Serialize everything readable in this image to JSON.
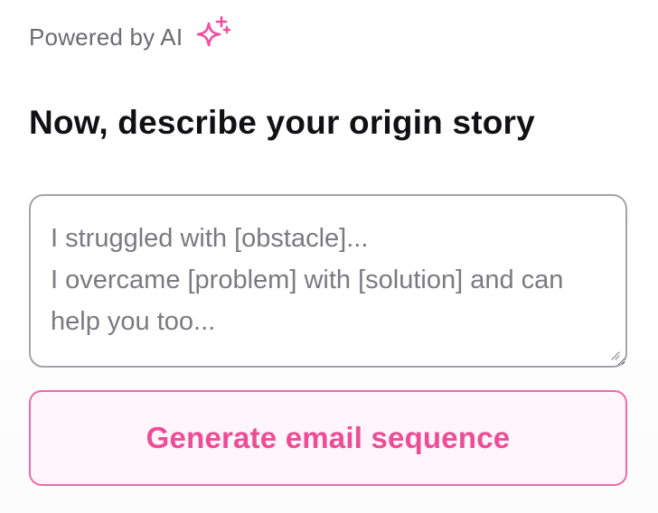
{
  "powered": {
    "text": "Powered by AI",
    "icon": "sparkle-icon",
    "icon_color": "#ee4fa0"
  },
  "heading": "Now, describe your origin story",
  "story": {
    "value": "",
    "placeholder": "I struggled with [obstacle]...\nI overcame [problem] with [solution] and can help you too..."
  },
  "generate_button": {
    "label": "Generate email sequence",
    "accent": "#ec4d97"
  }
}
